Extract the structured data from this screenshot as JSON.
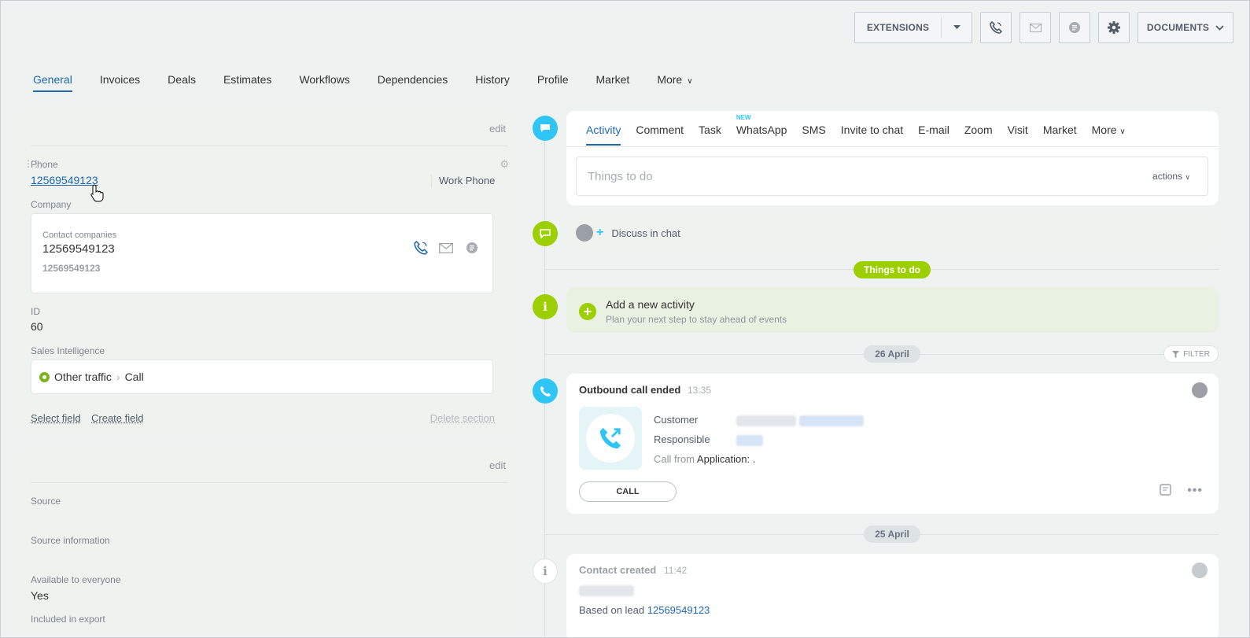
{
  "toolbar": {
    "extensions_label": "EXTENSIONS",
    "documents_label": "DOCUMENTS",
    "icons": [
      "phone-icon",
      "mail-icon",
      "chat-icon",
      "gear-icon"
    ]
  },
  "main_tabs": [
    "General",
    "Invoices",
    "Deals",
    "Estimates",
    "Workflows",
    "Dependencies",
    "History",
    "Profile",
    "Market",
    "More"
  ],
  "section1": {
    "edit_label": "edit",
    "phone_label": "Phone",
    "phone_value": "12569549123",
    "phone_type": "Work Phone",
    "company_label": "Company",
    "contact_companies_label": "Contact companies",
    "company_name": "12569549123",
    "company_sub": "12569549123",
    "id_label": "ID",
    "id_value": "60",
    "si_label": "Sales Intelligence",
    "si_source": "Other traffic",
    "si_channel": "Call",
    "select_field": "Select field",
    "create_field": "Create field",
    "delete_section": "Delete section"
  },
  "section2": {
    "edit_label": "edit",
    "source_label": "Source",
    "source_info_label": "Source information",
    "available_label": "Available to everyone",
    "available_value": "Yes",
    "export_label": "Included in export"
  },
  "activity": {
    "tabs": [
      "Activity",
      "Comment",
      "Task",
      "WhatsApp",
      "SMS",
      "Invite to chat",
      "E-mail",
      "Zoom",
      "Visit",
      "Market",
      "More"
    ],
    "new_badge": "NEW",
    "placeholder": "Things to do",
    "actions_label": "actions"
  },
  "timeline": {
    "discuss_chat": "Discuss in chat",
    "things_to_do": "Things to do",
    "add_activity_title": "Add a new activity",
    "add_activity_sub": "Plan your next step to stay ahead of events",
    "date1": "26 April",
    "filter_label": "FILTER",
    "call": {
      "title": "Outbound call ended",
      "time": "13:35",
      "customer_label": "Customer",
      "responsible_label": "Responsible",
      "call_from_label": "Call from",
      "call_from_value": "Application: .",
      "button": "CALL"
    },
    "date2": "25 April",
    "created": {
      "title": "Contact created",
      "time": "11:42",
      "based_on": "Based on lead",
      "lead_link": "12569549123"
    }
  },
  "colors": {
    "accent_blue": "#2067b0",
    "timeline_blue": "#2fc6f6",
    "timeline_green": "#9dcf00"
  }
}
